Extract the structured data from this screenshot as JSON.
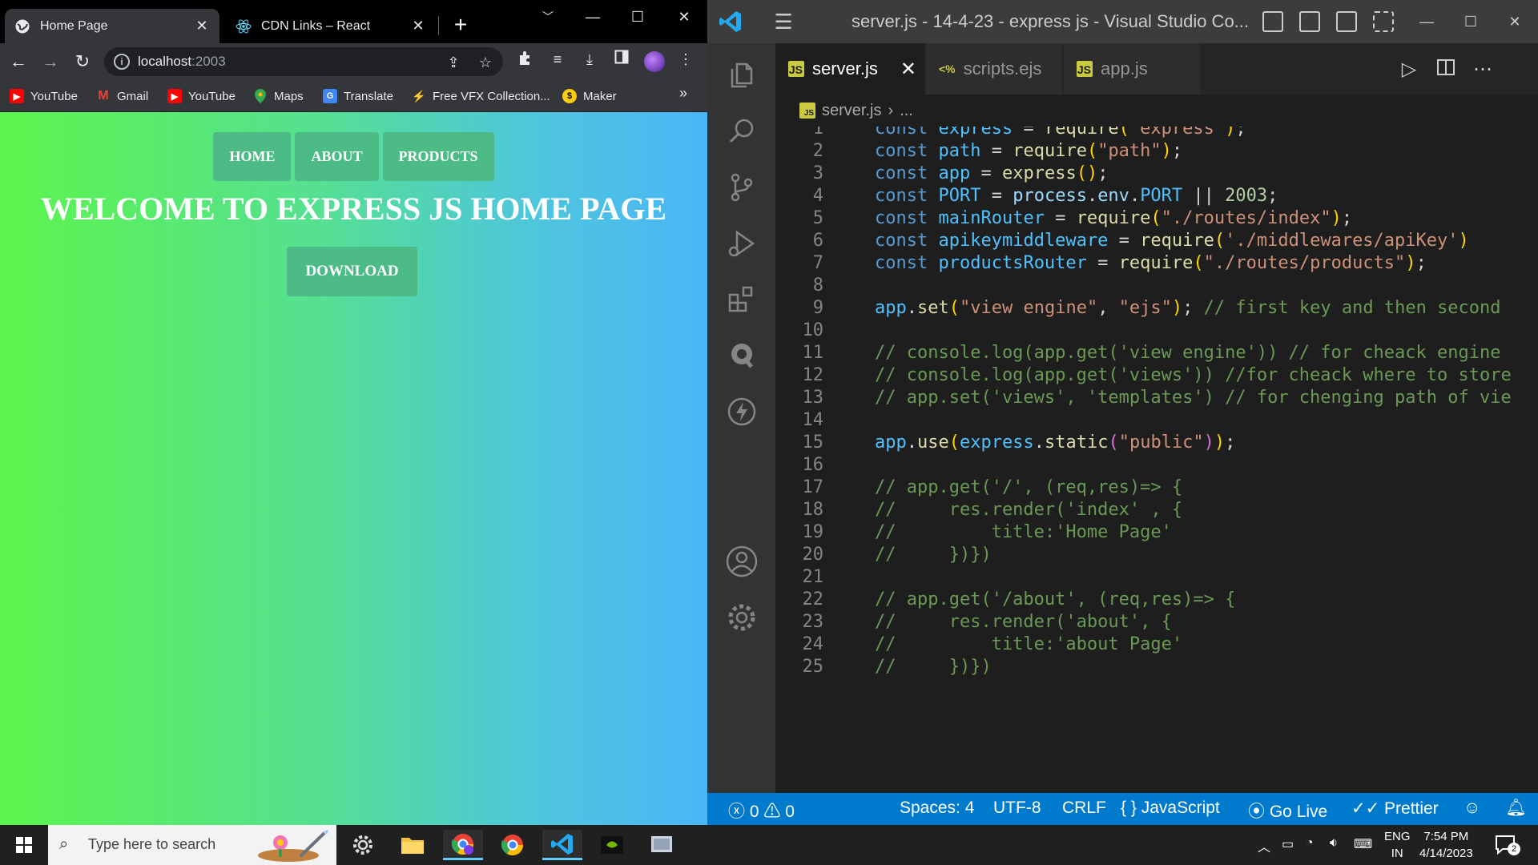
{
  "browser": {
    "tabs": [
      {
        "title": "Home Page",
        "active": true
      },
      {
        "title": "CDN Links – React",
        "active": false
      }
    ],
    "url_host": "localhost",
    "url_port": ":2003",
    "bookmarks": [
      {
        "label": "YouTube",
        "icon": "youtube-icon"
      },
      {
        "label": "Gmail",
        "icon": "gmail-icon"
      },
      {
        "label": "YouTube",
        "icon": "youtube-icon"
      },
      {
        "label": "Maps",
        "icon": "maps-icon"
      },
      {
        "label": "Translate",
        "icon": "translate-icon"
      },
      {
        "label": "Free VFX Collection...",
        "icon": "vfx-icon"
      },
      {
        "label": "Maker",
        "icon": "maker-icon"
      }
    ],
    "bookmarks_more": "»"
  },
  "site": {
    "nav": [
      "HOME",
      "ABOUT",
      "PRODUCTS"
    ],
    "title": "WELCOME TO EXPRESS JS HOME PAGE",
    "download": "DOWNLOAD",
    "button_color": "#4cbb86"
  },
  "vscode": {
    "window_title": "server.js - 14-4-23 - express js - Visual Studio Co...",
    "tabs": [
      {
        "label": "server.js",
        "icon": "js-file-icon",
        "active": true
      },
      {
        "label": "scripts.ejs",
        "icon": "ejs-file-icon",
        "active": false
      },
      {
        "label": "app.js",
        "icon": "js-file-icon",
        "active": false
      }
    ],
    "breadcrumb_file": "server.js",
    "breadcrumb_more": "...",
    "code_lines": [
      "const express = require(\"express\");",
      "const path = require(\"path\");",
      "const app = express();",
      "const PORT = process.env.PORT || 2003;",
      "const mainRouter = require(\"./routes/index\");",
      "const apikeymiddleware = require('./middlewares/apiKey')",
      "const productsRouter = require(\"./routes/products\");",
      "",
      "app.set(\"view engine\", \"ejs\"); // first key and then second",
      "",
      "// console.log(app.get('view engine')) // for cheack engine",
      "// console.log(app.get('views')) //for cheack where to store",
      "// app.set('views', 'templates') // for chenging path of vie",
      "",
      "app.use(express.static(\"public\"));",
      "",
      "// app.get('/', (req,res)=> {",
      "//     res.render('index' , {",
      "//         title:'Home Page'",
      "//     })})",
      "",
      "// app.get('/about', (req,res)=> {",
      "//     res.render('about', {",
      "//         title:'about Page'",
      "//     })})"
    ],
    "status": {
      "errors": "0",
      "warnings": "0",
      "spaces": "Spaces: 4",
      "encoding": "UTF-8",
      "eol": "CRLF",
      "language": "JavaScript",
      "golive": "Go Live",
      "prettier": "Prettier"
    },
    "accent": "#007acc"
  },
  "taskbar": {
    "search_placeholder": "Type here to search",
    "lang_top": "ENG",
    "lang_bottom": "IN",
    "time": "7:54 PM",
    "date": "4/14/2023",
    "notifications": "2"
  }
}
